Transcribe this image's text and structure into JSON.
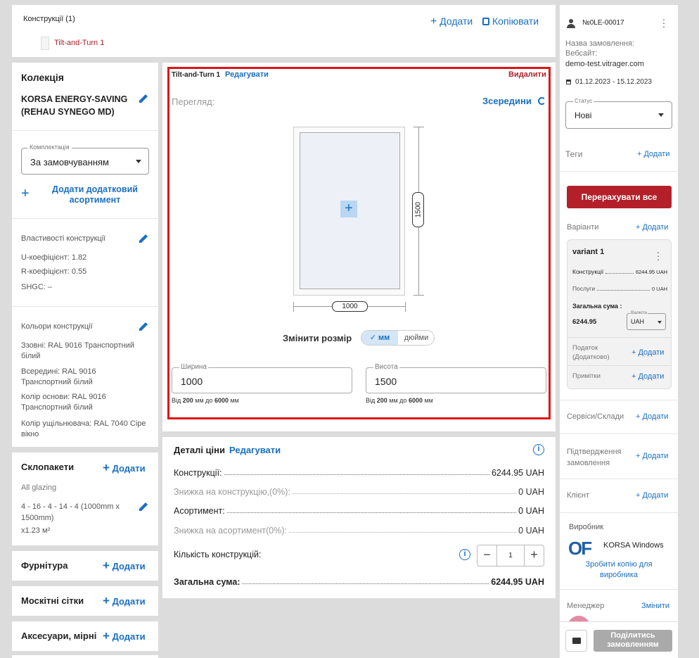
{
  "top": {
    "constructions_title": "Конструкції (1)",
    "add_label": "Додати",
    "copy_label": "Копіювати",
    "item_label": "Tilt-and-Turn 1"
  },
  "left": {
    "collection_title": "Колекція",
    "collection_name_1": "KORSA ENERGY-SAVING",
    "collection_name_2": "(REHAU SYNEGO MD)",
    "kit_label": "Комплектація",
    "kit_value": "За замовчуванням",
    "add_assortment_1": "Додати додатковий",
    "add_assortment_2": "асортимент",
    "props_title": "Властивості конструкції",
    "u_coef": "U-коефіцієнт: 1.82",
    "r_coef": "R-коефіцієнт: 0.55",
    "shgc": "SHGC: –",
    "colors_title": "Кольори конструкції",
    "outside_1": "Ззовні: RAL 9016 Транспортний",
    "outside_2": "білий",
    "inside_1": "Всередині: RAL 9016",
    "inside_2": "Транспортний білий",
    "base_1": "Колір основи: RAL 9016",
    "base_2": "Транспортний білий",
    "seal_1": "Колір ущільнювача: RAL 7040 Сіре",
    "seal_2": "вікно",
    "glazing_title": "Склопакети",
    "glazing_add": "Додати",
    "glazing_all": "All glazing",
    "glazing_spec_1": "4 - 16 - 4 - 14 - 4 (1000mm x",
    "glazing_spec_2": "1500mm)",
    "glazing_area": "x1.23 м²",
    "hardware_title": "Фурнітура",
    "hardware_add": "Додати",
    "mosquito_title": "Москітні сітки",
    "mosquito_add": "Додати",
    "accessories_title": "Аксесуари, мірні",
    "accessories_add": "Додати"
  },
  "editor": {
    "name": "Tilt-and-Turn 1",
    "edit": "Редагувати",
    "delete": "Видалити",
    "view_label": "Перегляд:",
    "view_side": "Зсередини",
    "height_dim": "1500",
    "width_dim": "1000",
    "resize_label": "Змінити розмір",
    "unit_mm": "мм",
    "unit_inch": "дюйми",
    "width_label": "Ширина",
    "width_value": "1000",
    "width_hint_pre": "Від ",
    "width_min": "200",
    "width_hint_mid": " мм до ",
    "width_max": "6000",
    "width_hint_post": " мм",
    "height_label": "Висота",
    "height_value": "1500",
    "height_hint_pre": "Від ",
    "height_min": "200",
    "height_hint_mid": " мм до ",
    "height_max": "6000",
    "height_hint_post": " мм"
  },
  "price": {
    "title": "Деталі ціни",
    "edit": "Редагувати",
    "rows": [
      {
        "label": "Конструкції:",
        "value": "6244.95 UAH"
      },
      {
        "label": "Знижка на конструкцію,(0%):",
        "value": "0 UAH"
      },
      {
        "label": "Асортимент:",
        "value": "0 UAH"
      },
      {
        "label": "Знижка на асортимент(0%):",
        "value": "0 UAH"
      }
    ],
    "qty_label": "Кількість конструкцій:",
    "qty_value": "1",
    "total_label": "Загальна сума:",
    "total_value": "6244.95 UAH"
  },
  "right": {
    "order_no": "№0LE-00017",
    "order_name_label": "Назва замовлення:",
    "website_label": "Вебсайт:",
    "website": "demo-test.vitrager.com",
    "dates": "01.12.2023 - 15.12.2023",
    "status_label": "Статус",
    "status_value": "Нові",
    "tags_label": "Теги",
    "add": "Додати",
    "recalc": "Перерахувати все",
    "variants_label": "Варіанти",
    "variant_name": "variant 1",
    "v_constructions": "Конструкції",
    "v_constructions_val": "6244.95 UAH",
    "v_services": "Послуги",
    "v_services_val": "0 UAH",
    "v_total_label": "Загальна сума :",
    "v_total_value": "6244.95",
    "currency_label": "Валюта",
    "currency_value": "UAH",
    "tax_1": "Податок",
    "tax_2": "(Додатково)",
    "notes": "Примітки",
    "services_label": "Сервіси/Склади",
    "confirm_1": "Підтвердження",
    "confirm_2": "замовлення",
    "client_label": "Клієнт",
    "producer_label": "Виробник",
    "producer_name": "KORSA Windows",
    "copy_1": "Зробити копію для",
    "copy_2": "виробника",
    "manager_label": "Менеджер",
    "change": "Змінити",
    "share_1": "Поділитись",
    "share_2": "замовленням"
  }
}
